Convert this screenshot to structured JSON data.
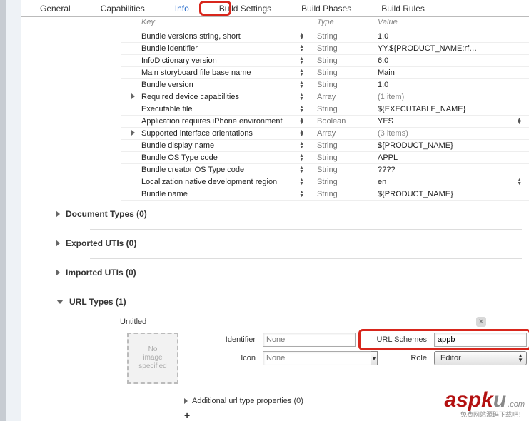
{
  "tabs": {
    "general": "General",
    "capabilities": "Capabilities",
    "info": "Info",
    "build_settings": "Build Settings",
    "build_phases": "Build Phases",
    "build_rules": "Build Rules"
  },
  "plist_header": {
    "key": "Key",
    "type": "Type",
    "value": "Value"
  },
  "plist_rows": [
    {
      "key": "Bundle versions string, short",
      "type": "String",
      "value": "1.0",
      "stepper_v": false
    },
    {
      "key": "Bundle identifier",
      "type": "String",
      "value": "YY.${PRODUCT_NAME:rf…",
      "stepper_v": false
    },
    {
      "key": "InfoDictionary version",
      "type": "String",
      "value": "6.0",
      "stepper_v": false
    },
    {
      "key": "Main storyboard file base name",
      "type": "String",
      "value": "Main",
      "stepper_v": false
    },
    {
      "key": "Bundle version",
      "type": "String",
      "value": "1.0",
      "stepper_v": false
    },
    {
      "key": "Required device capabilities",
      "type": "Array",
      "value": "(1 item)",
      "disclosure": true,
      "italic": true
    },
    {
      "key": "Executable file",
      "type": "String",
      "value": "${EXECUTABLE_NAME}",
      "stepper_v": false
    },
    {
      "key": "Application requires iPhone environment",
      "type": "Boolean",
      "value": "YES",
      "stepper_v": true
    },
    {
      "key": "Supported interface orientations",
      "type": "Array",
      "value": "(3 items)",
      "disclosure": true,
      "italic": true
    },
    {
      "key": "Bundle display name",
      "type": "String",
      "value": "${PRODUCT_NAME}",
      "stepper_v": false
    },
    {
      "key": "Bundle OS Type code",
      "type": "String",
      "value": "APPL",
      "stepper_v": false
    },
    {
      "key": "Bundle creator OS Type code",
      "type": "String",
      "value": "????",
      "stepper_v": false
    },
    {
      "key": "Localization native development region",
      "type": "String",
      "value": "en",
      "stepper_v": true
    },
    {
      "key": "Bundle name",
      "type": "String",
      "value": "${PRODUCT_NAME}",
      "stepper_v": false
    }
  ],
  "sections": {
    "document_types": "Document Types (0)",
    "exported_utis": "Exported UTIs (0)",
    "imported_utis": "Imported UTIs (0)",
    "url_types": "URL Types (1)"
  },
  "url_type": {
    "untitled": "Untitled",
    "img_well": "No\nimage\nspecified",
    "identifier_label": "Identifier",
    "identifier_value": "None",
    "url_schemes_label": "URL Schemes",
    "url_schemes_value": "appb",
    "icon_label": "Icon",
    "icon_value": "None",
    "role_label": "Role",
    "role_value": "Editor",
    "additional": "Additional url type properties (0)",
    "plus": "+"
  },
  "watermark": {
    "brand_red": "aspk",
    "brand_gray": "u",
    "dom": ".com",
    "sub": "免费网站源码下载吧！"
  }
}
